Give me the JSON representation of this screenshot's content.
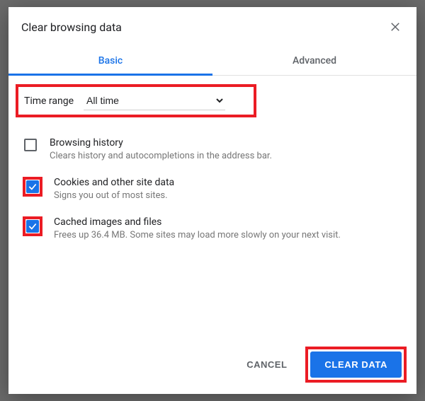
{
  "dialog": {
    "title": "Clear browsing data"
  },
  "tabs": {
    "basic": "Basic",
    "advanced": "Advanced"
  },
  "timeRange": {
    "label": "Time range",
    "value": "All time"
  },
  "options": [
    {
      "title": "Browsing history",
      "desc": "Clears history and autocompletions in the address bar.",
      "checked": false,
      "highlight": false
    },
    {
      "title": "Cookies and other site data",
      "desc": "Signs you out of most sites.",
      "checked": true,
      "highlight": true
    },
    {
      "title": "Cached images and files",
      "desc": "Frees up 36.4 MB. Some sites may load more slowly on your next visit.",
      "checked": true,
      "highlight": true
    }
  ],
  "footer": {
    "cancel": "CANCEL",
    "clear": "CLEAR DATA"
  }
}
